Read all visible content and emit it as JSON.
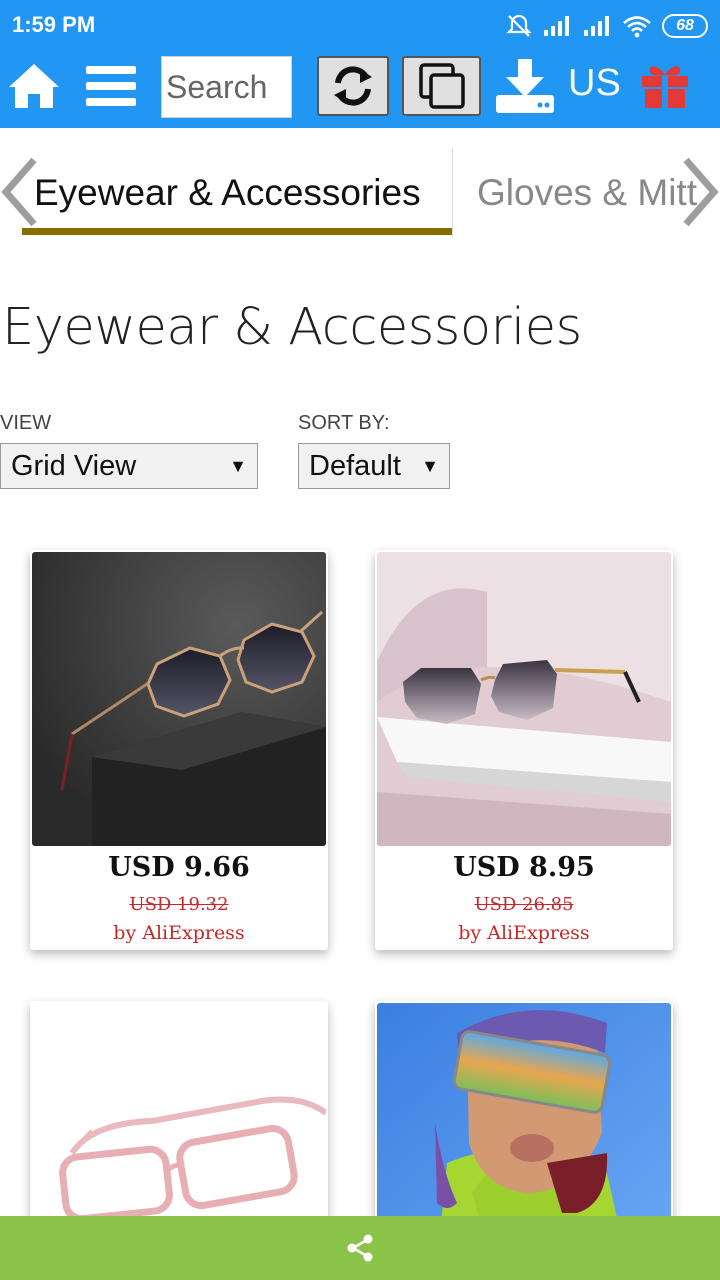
{
  "status_bar": {
    "time": "1:59 PM",
    "battery": "68"
  },
  "toolbar": {
    "search_placeholder": "Search",
    "region": "US",
    "icons": [
      "home-icon",
      "menu-icon",
      "refresh-icon",
      "copy-icon",
      "download-icon",
      "gift-icon"
    ]
  },
  "category_tabs": {
    "active": "Eyewear & Accessories",
    "next": "Gloves & Mitt"
  },
  "page": {
    "title": "Eyewear & Accessories"
  },
  "filters": {
    "view_label": "VIEW",
    "view_value": "Grid View",
    "sort_label": "SORT BY:",
    "sort_value": "Default"
  },
  "products": [
    {
      "price": "USD 9.66",
      "old_price": "USD 19.32",
      "seller": "by AliExpress"
    },
    {
      "price": "USD 8.95",
      "old_price": "USD 26.85",
      "seller": "by AliExpress"
    },
    {
      "price": "",
      "old_price": "",
      "seller": ""
    },
    {
      "price": "",
      "old_price": "",
      "seller": ""
    }
  ],
  "colors": {
    "header": "#2196f3",
    "tab_underline": "#8a6d00",
    "sale_red": "#c62828",
    "share_bar": "#8bc34a",
    "gift": "#e53935"
  }
}
